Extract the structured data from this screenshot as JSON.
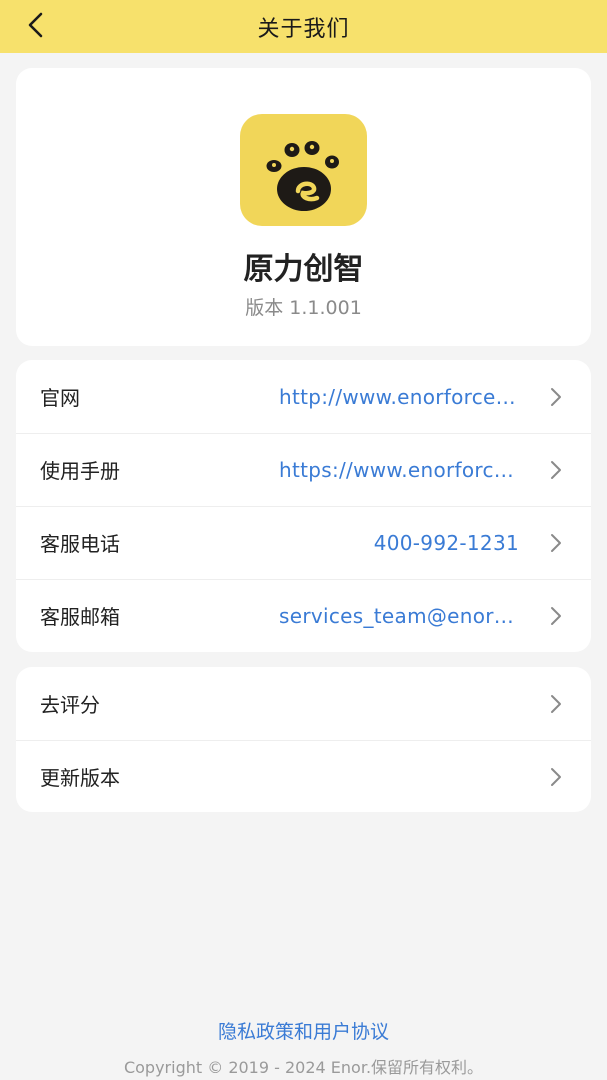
{
  "navbar": {
    "title": "关于我们",
    "back_icon": "back-arrow-icon"
  },
  "about": {
    "logo_icon": "paw-logo-icon",
    "logo_color": "#f1d659",
    "app_name": "原力创智",
    "version": "版本 1.1.001"
  },
  "links": [
    {
      "label": "官网",
      "value": "http://www.enorforce.com"
    },
    {
      "label": "使用手册",
      "value": "https://www.enorforce.com"
    },
    {
      "label": "客服电话",
      "value": "400-992-1231"
    },
    {
      "label": "客服邮箱",
      "value": "services_team@enorforce.com"
    }
  ],
  "actions": [
    {
      "label": "去评分"
    },
    {
      "label": "更新版本"
    }
  ],
  "footer": {
    "privacy": "隐私政策和用户协议",
    "copyright": "Copyright © 2019 - 2024 Enor.保留所有权利。"
  },
  "colors": {
    "navbar": "#f7e16c",
    "link": "#3a7bd5",
    "background": "#f4f4f4"
  }
}
